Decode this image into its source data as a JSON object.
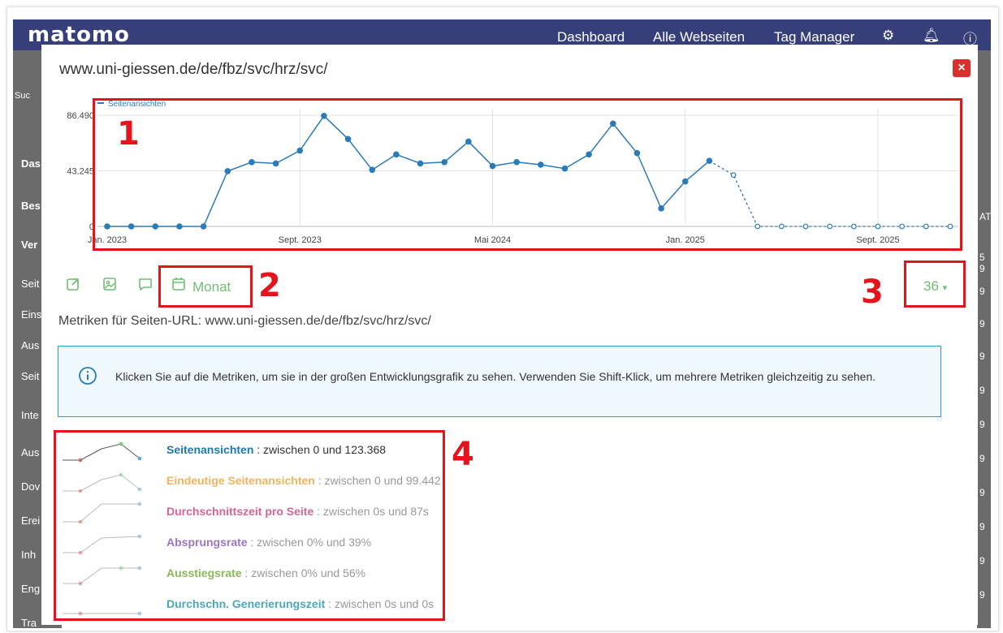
{
  "topbar": {
    "logo": "matomo",
    "nav": [
      "Dashboard",
      "Alle Webseiten",
      "Tag Manager"
    ]
  },
  "background_sidebar": [
    "Suc",
    "Das",
    "Bes",
    "Ver",
    "Seit",
    "Eins",
    "Aus",
    "Seit",
    "Inte",
    "Aus",
    "Dov",
    "Erei",
    "Inh",
    "Eng",
    "Tra"
  ],
  "background_right": [
    "AT",
    "5 9",
    "9",
    "9",
    "9",
    "9",
    "9",
    "9",
    "9",
    "9",
    "9",
    "9"
  ],
  "modal": {
    "title": "www.uni-giessen.de/de/fbz/svc/hrz/svc/",
    "close_label": "×"
  },
  "annotations": [
    "1",
    "2",
    "3",
    "4"
  ],
  "chart_data": {
    "type": "line",
    "legend": "Seitenansichten",
    "yticks": [
      "86.490",
      "43.245",
      "0"
    ],
    "ylim": [
      0,
      86490
    ],
    "xticks": [
      "Jan. 2023",
      "Sept. 2023",
      "Mai 2024",
      "Jan. 2025",
      "Sept. 2025"
    ],
    "xtick_indices": [
      0,
      8,
      16,
      24,
      32
    ],
    "series": [
      {
        "name": "Seitenansichten",
        "color": "#2b7bb9",
        "values": [
          0,
          0,
          0,
          0,
          0,
          43000,
          50000,
          49000,
          59000,
          86000,
          68000,
          44000,
          56000,
          49000,
          50000,
          66000,
          47000,
          50000,
          48000,
          45000,
          56000,
          80000,
          57000,
          14000,
          35000,
          51000,
          40000,
          0,
          0,
          0,
          0,
          0,
          0,
          0,
          0,
          0
        ],
        "dashed_from_index": 25,
        "hollow_from_index": 26
      }
    ]
  },
  "toolbar": {
    "export_icon": "export-icon",
    "image_icon": "image-icon",
    "annotation_icon": "comment-icon",
    "calendar_icon": "calendar-icon",
    "period": "Monat",
    "limit": "36"
  },
  "metrics_title": "Metriken für Seiten-URL: www.uni-giessen.de/de/fbz/svc/hrz/svc/",
  "info_box": {
    "text": "Klicken Sie auf die Metriken, um sie in der großen Entwicklungsgrafik zu sehen. Verwenden Sie Shift-Klick, um mehrere Metriken gleichzeitig zu sehen."
  },
  "metrics": [
    {
      "name": "Seitenansichten",
      "range": ": zwischen 0 und 123.368",
      "color": "#1f78b4",
      "active": true
    },
    {
      "name": "Eindeutige Seitenansichten",
      "range": ": zwischen 0 und 99.442",
      "color": "#f3b35c",
      "active": false
    },
    {
      "name": "Durchschnittszeit pro Seite",
      "range": ": zwischen 0s und 87s",
      "color": "#d6649a",
      "active": false
    },
    {
      "name": "Absprungsrate",
      "range": ": zwischen 0% und 39%",
      "color": "#9b74c9",
      "active": false
    },
    {
      "name": "Ausstiegsrate",
      "range": ": zwischen 0% und 56%",
      "color": "#8ab85a",
      "active": false
    },
    {
      "name": "Durchschn. Generierungszeit",
      "range": ": zwischen 0s und 0s",
      "color": "#4aa8b8",
      "active": false
    }
  ]
}
